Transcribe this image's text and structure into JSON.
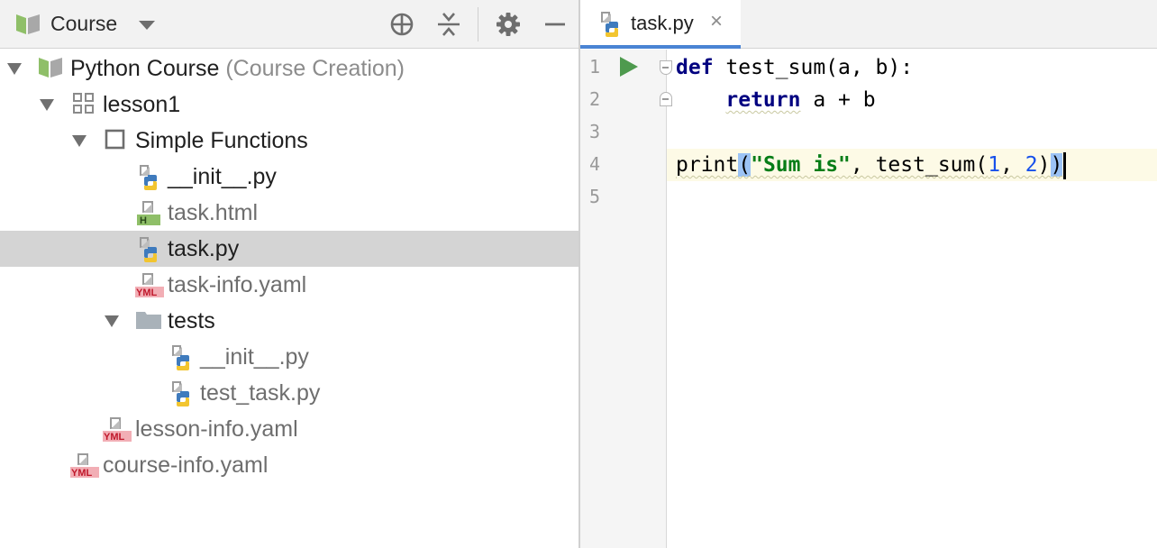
{
  "project_toolbar": {
    "title": "Course",
    "icons": [
      "book-icon",
      "chevron-down-icon",
      "locate-icon",
      "collapse-all-icon",
      "gear-icon",
      "minimize-icon"
    ]
  },
  "tree": {
    "root": {
      "name": "Python Course",
      "suffix": "(Course Creation)"
    },
    "lesson": "lesson1",
    "task": "Simple Functions",
    "task_files": [
      "__init__.py",
      "task.html",
      "task.py",
      "task-info.yaml"
    ],
    "tests_folder": "tests",
    "test_files": [
      "__init__.py",
      "test_task.py"
    ],
    "lesson_info": "lesson-info.yaml",
    "course_info": "course-info.yaml",
    "selected": "task.py"
  },
  "editor": {
    "tab": {
      "label": "task.py",
      "close": "×"
    },
    "line_numbers": [
      "1",
      "2",
      "3",
      "4",
      "5"
    ],
    "code": {
      "line1": {
        "kw": "def",
        "rest": " test_sum(a, b):"
      },
      "line2": {
        "indent": "    ",
        "kw": "return",
        "rest": " a + b"
      },
      "line4": {
        "fn": "print",
        "open": "(",
        "str": "\"Sum is\"",
        "mid": ", test_sum(",
        "n1": "1",
        "comma": ", ",
        "n2": "2",
        "close_inner": ")",
        "close": ")"
      }
    }
  },
  "colors": {
    "keyword": "#000080",
    "string": "#067d17",
    "number": "#1750eb",
    "run_green": "#4e9a4e",
    "tab_underline": "#4a84d4",
    "selection": "#d4d4d4",
    "current_line": "#fdfae6"
  }
}
